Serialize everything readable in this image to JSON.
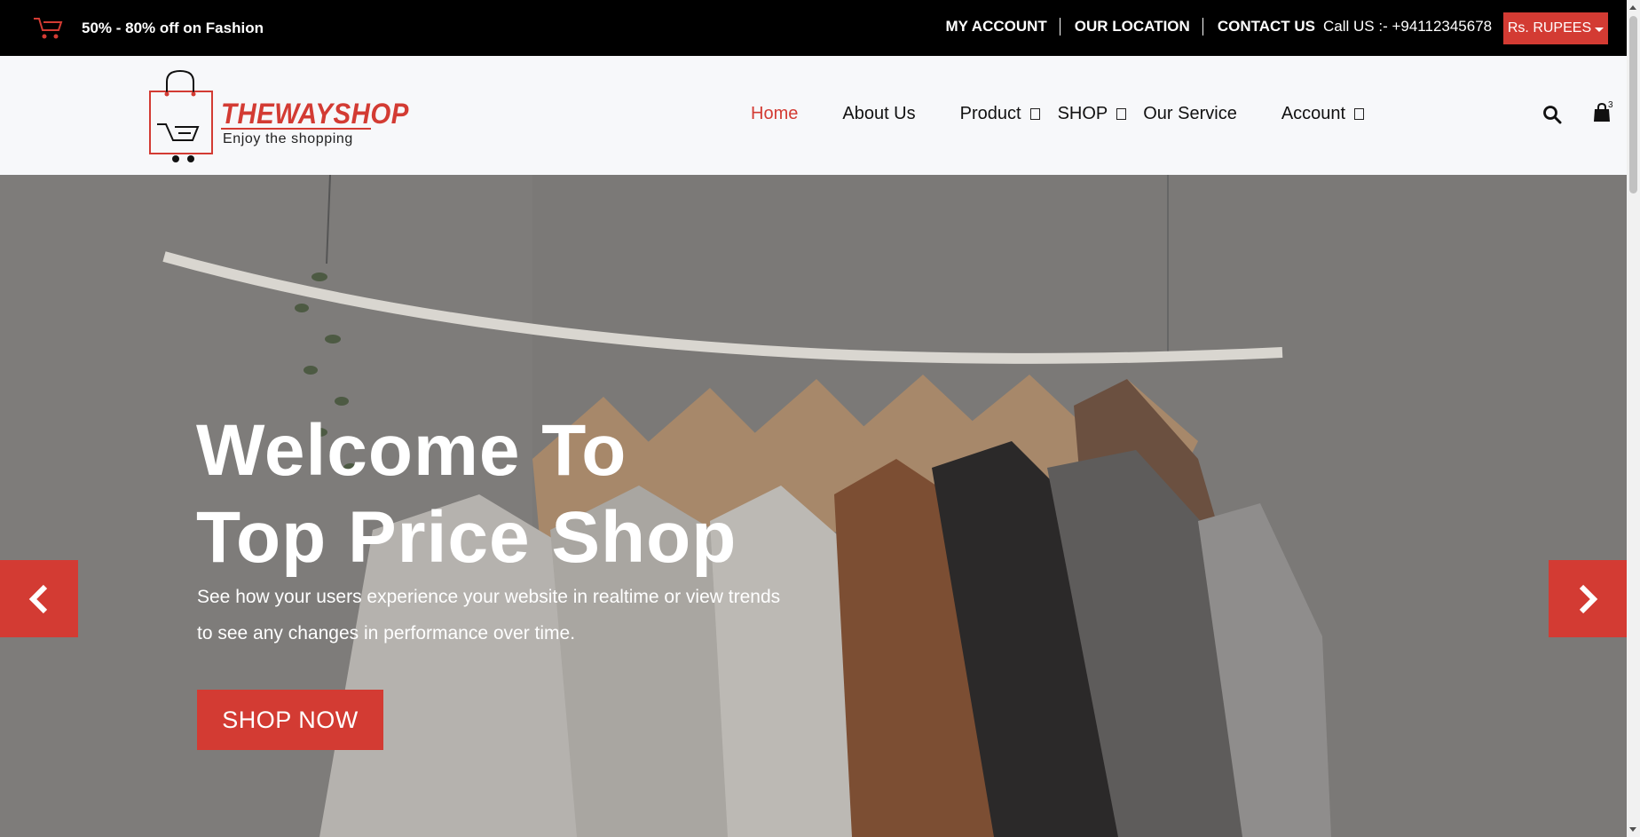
{
  "topbar": {
    "promo_text": "50% - 80% off on Fashion",
    "links": [
      "MY ACCOUNT",
      "OUR LOCATION",
      "CONTACT US"
    ],
    "call_us": "Call US :- +94112345678",
    "currency": "Rs. RUPEES",
    "promo_icon": "cart-icon"
  },
  "header": {
    "brand_name": "THEWAYSHOP",
    "brand_tagline": "Enjoy the shopping",
    "menu": [
      "Home",
      "About Us",
      "Product",
      "SHOP",
      "Our Service",
      "Account"
    ],
    "active_menu": "Home",
    "cart_count": "3",
    "icons": [
      "search-icon",
      "shopping-bag-icon"
    ]
  },
  "hero": {
    "title_line1": "Welcome To",
    "title_line2": "Top Price Shop",
    "subtitle": "See how your users experience your website in realtime or view trends to see any changes in performance over time.",
    "button": "SHOP NOW",
    "prev_icon": "chevron-left-icon",
    "next_icon": "chevron-right-icon"
  },
  "colors": {
    "accent": "#d33b33",
    "topbar_bg": "#000000",
    "nav_bg": "#f7f8fa"
  }
}
